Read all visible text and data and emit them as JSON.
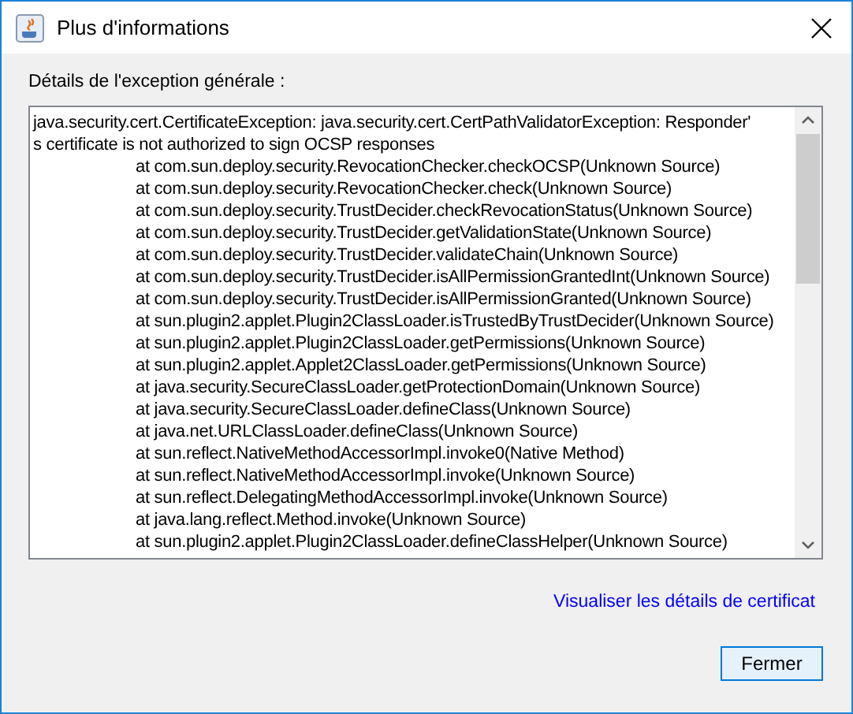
{
  "window": {
    "title": "Plus d'informations"
  },
  "details_label": "Détails de l'exception générale :",
  "details_lines": [
    {
      "kind": "message",
      "text": "java.security.cert.CertificateException: java.security.cert.CertPathValidatorException: Responder'"
    },
    {
      "kind": "message",
      "text": "s certificate is not authorized to sign OCSP responses"
    },
    {
      "kind": "frame",
      "text": "at com.sun.deploy.security.RevocationChecker.checkOCSP(Unknown Source)"
    },
    {
      "kind": "frame",
      "text": "at com.sun.deploy.security.RevocationChecker.check(Unknown Source)"
    },
    {
      "kind": "frame",
      "text": "at com.sun.deploy.security.TrustDecider.checkRevocationStatus(Unknown Source)"
    },
    {
      "kind": "frame",
      "text": "at com.sun.deploy.security.TrustDecider.getValidationState(Unknown Source)"
    },
    {
      "kind": "frame",
      "text": "at com.sun.deploy.security.TrustDecider.validateChain(Unknown Source)"
    },
    {
      "kind": "frame",
      "text": "at com.sun.deploy.security.TrustDecider.isAllPermissionGrantedInt(Unknown Source)"
    },
    {
      "kind": "frame",
      "text": "at com.sun.deploy.security.TrustDecider.isAllPermissionGranted(Unknown Source)"
    },
    {
      "kind": "frame",
      "text": "at sun.plugin2.applet.Plugin2ClassLoader.isTrustedByTrustDecider(Unknown Source)"
    },
    {
      "kind": "frame",
      "text": "at sun.plugin2.applet.Plugin2ClassLoader.getPermissions(Unknown Source)"
    },
    {
      "kind": "frame",
      "text": "at sun.plugin2.applet.Applet2ClassLoader.getPermissions(Unknown Source)"
    },
    {
      "kind": "frame",
      "text": "at java.security.SecureClassLoader.getProtectionDomain(Unknown Source)"
    },
    {
      "kind": "frame",
      "text": "at java.security.SecureClassLoader.defineClass(Unknown Source)"
    },
    {
      "kind": "frame",
      "text": "at java.net.URLClassLoader.defineClass(Unknown Source)"
    },
    {
      "kind": "frame",
      "text": "at sun.reflect.NativeMethodAccessorImpl.invoke0(Native Method)"
    },
    {
      "kind": "frame",
      "text": "at sun.reflect.NativeMethodAccessorImpl.invoke(Unknown Source)"
    },
    {
      "kind": "frame",
      "text": "at sun.reflect.DelegatingMethodAccessorImpl.invoke(Unknown Source)"
    },
    {
      "kind": "frame",
      "text": "at java.lang.reflect.Method.invoke(Unknown Source)"
    },
    {
      "kind": "frame",
      "text": "at sun.plugin2.applet.Plugin2ClassLoader.defineClassHelper(Unknown Source)"
    }
  ],
  "certificate_link": "Visualiser les détails de certificat",
  "buttons": [
    "Fermer"
  ]
}
